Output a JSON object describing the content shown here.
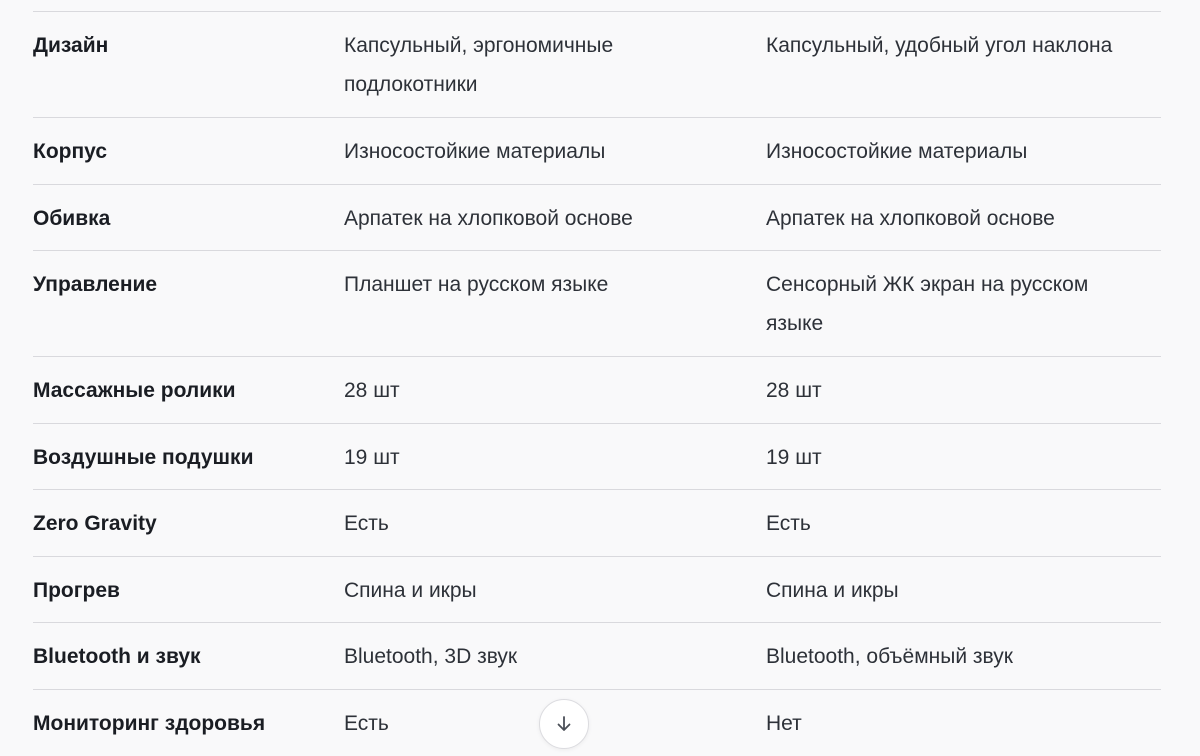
{
  "rows": [
    {
      "feature": "Дизайн",
      "col1": "Капсульный, эргономичные подлокотники",
      "col2": "Капсульный, удобный угол наклона"
    },
    {
      "feature": "Корпус",
      "col1": "Износостойкие материалы",
      "col2": "Износостойкие материалы"
    },
    {
      "feature": "Обивка",
      "col1": "Арпатек на хлопковой основе",
      "col2": "Арпатек на хлопковой основе"
    },
    {
      "feature": "Управление",
      "col1": "Планшет на русском языке",
      "col2": "Сенсорный ЖК экран на русском языке"
    },
    {
      "feature": "Массажные ролики",
      "col1": "28 шт",
      "col2": "28 шт"
    },
    {
      "feature": "Воздушные подушки",
      "col1": "19 шт",
      "col2": "19 шт"
    },
    {
      "feature": "Zero Gravity",
      "col1": "Есть",
      "col2": "Есть"
    },
    {
      "feature": "Прогрев",
      "col1": "Спина и икры",
      "col2": "Спина и икры"
    },
    {
      "feature": "Bluetooth и звук",
      "col1": "Bluetooth, 3D звук",
      "col2": "Bluetooth, объёмный звук"
    },
    {
      "feature": "Мониторинг здоровья",
      "col1": "Есть",
      "col2": "Нет"
    }
  ],
  "scroll_button": {
    "icon": "arrow-down-icon"
  },
  "colors": {
    "background": "#f9f9fa",
    "divider": "#d9d9dd",
    "text": "#2d3138",
    "header_text": "#1a1d23"
  }
}
